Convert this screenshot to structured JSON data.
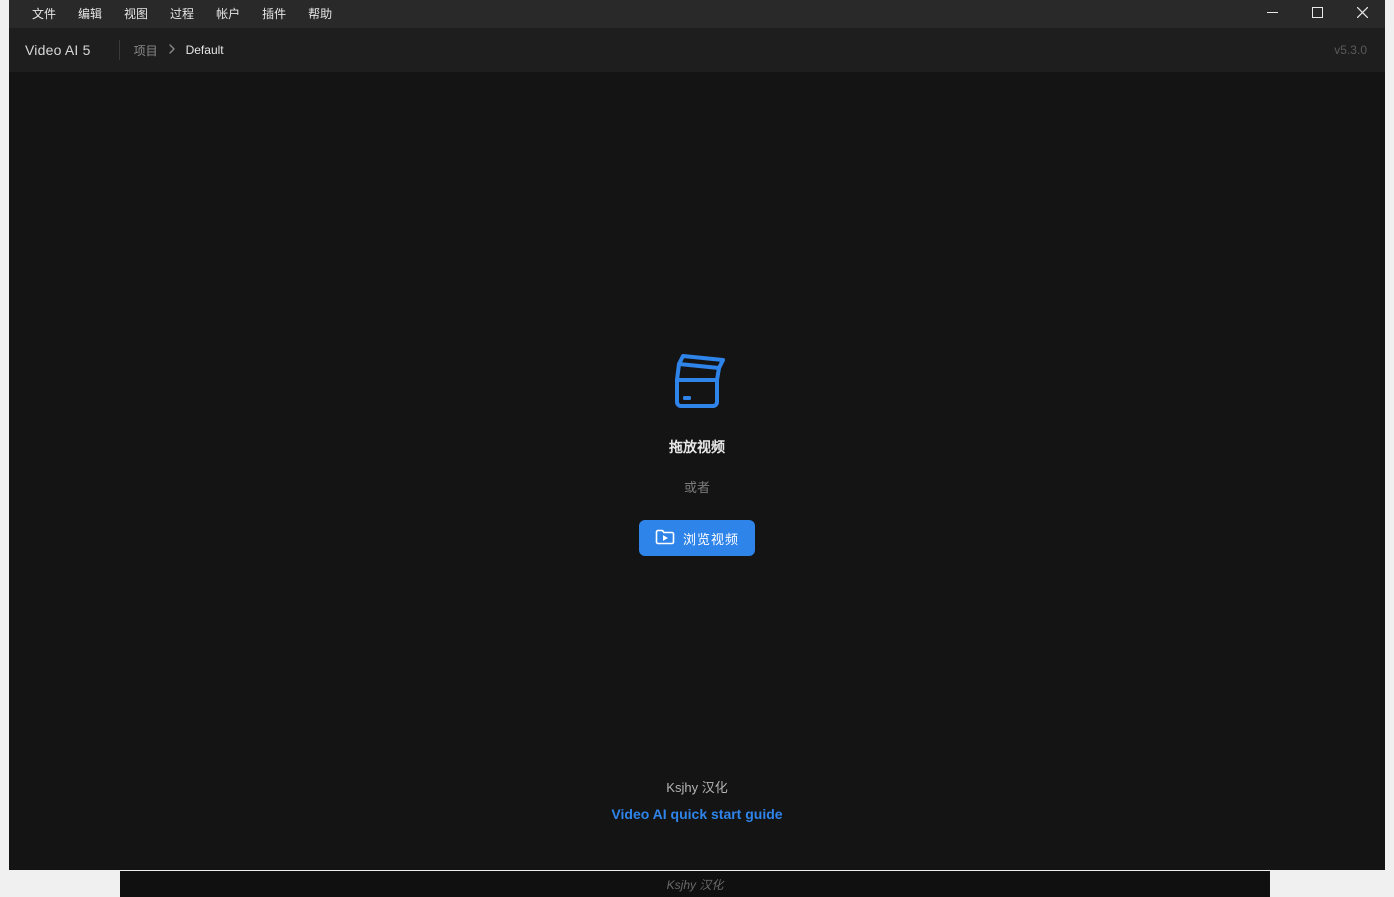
{
  "menubar": {
    "items": [
      "文件",
      "编辑",
      "视图",
      "过程",
      "帐户",
      "插件",
      "帮助"
    ]
  },
  "header": {
    "app_title": "Video AI  5",
    "breadcrumb_root": "项目",
    "breadcrumb_current": "Default",
    "version": "v5.3.0"
  },
  "dropzone": {
    "title": "拖放视频",
    "or": "或者",
    "browse_label": "浏览视频"
  },
  "footer": {
    "credit": "Ksjhy 汉化",
    "guide": "Video AI quick start guide"
  },
  "under": {
    "credit": "Ksjhy 汉化"
  }
}
